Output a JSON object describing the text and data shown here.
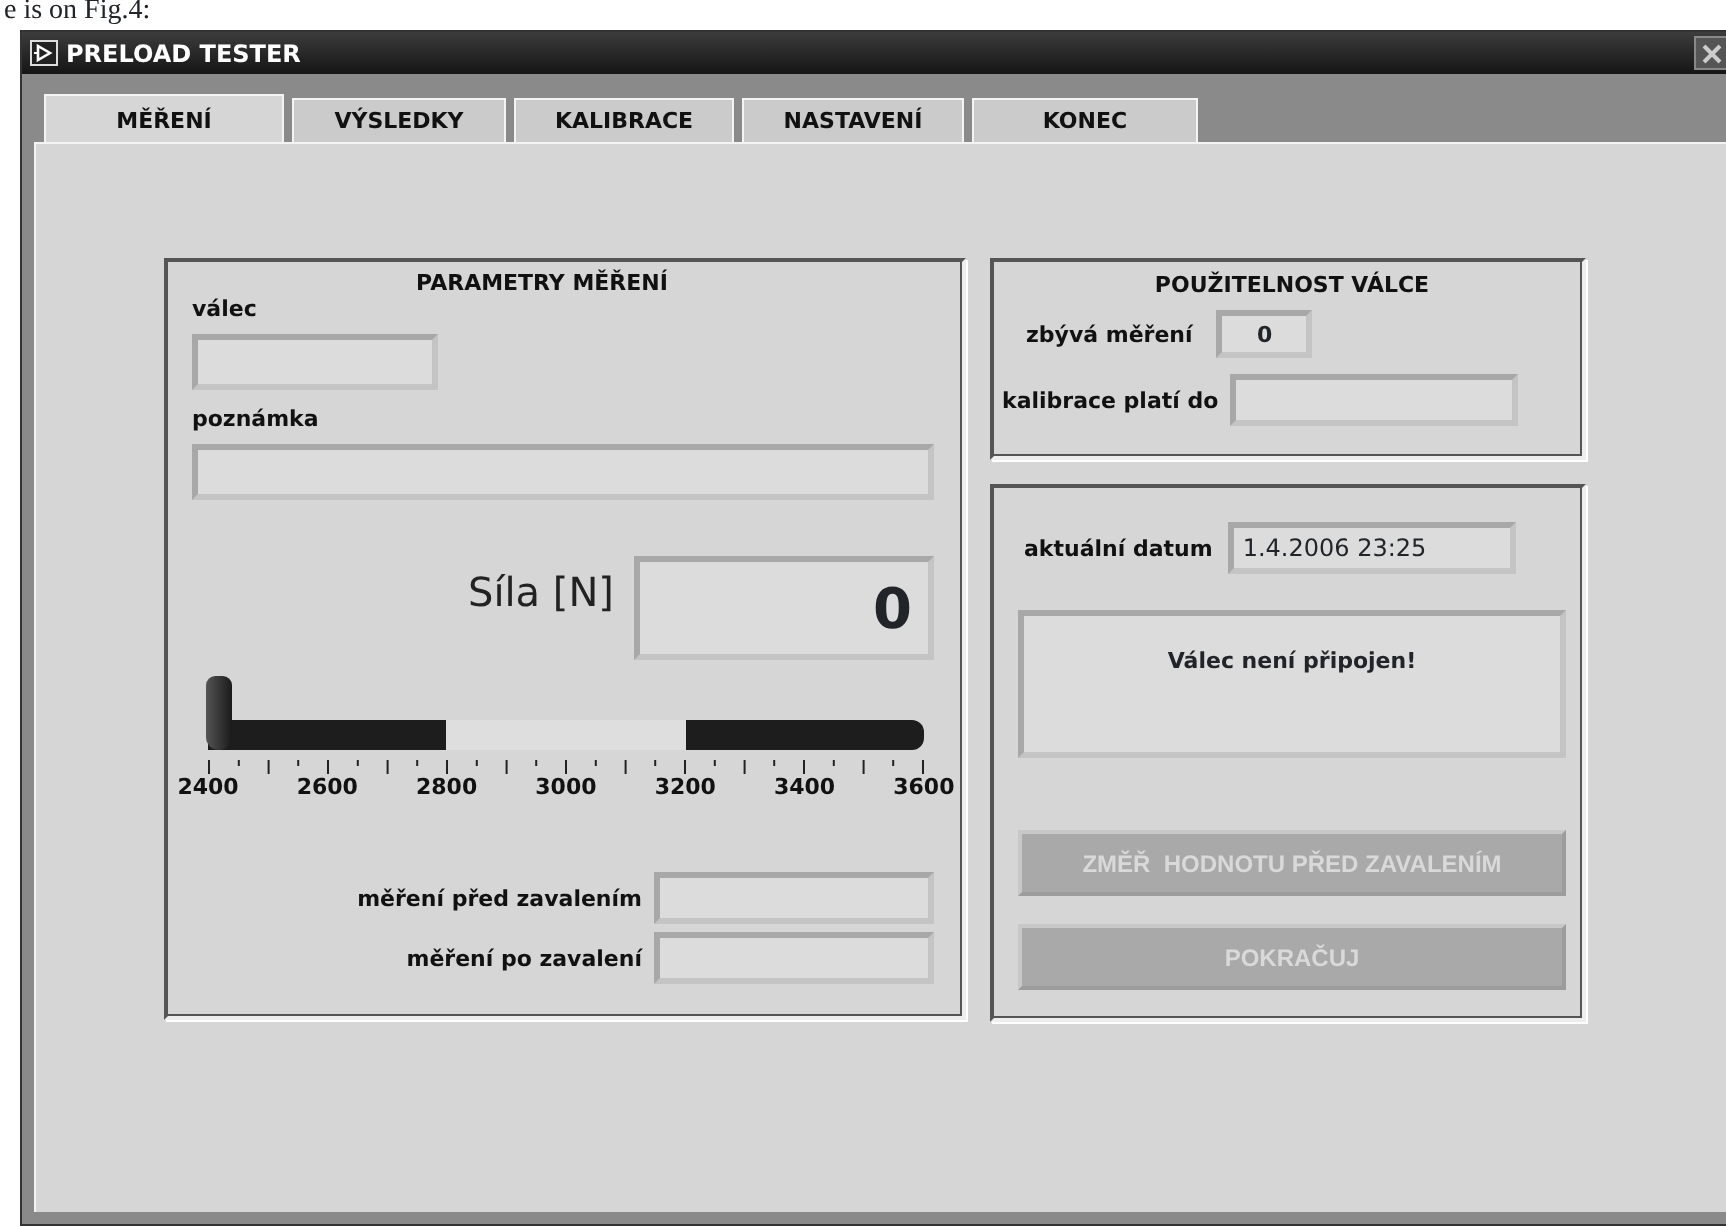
{
  "document_caption": "e is on Fig.4:",
  "window": {
    "title": "PRELOAD TESTER"
  },
  "tabs": [
    {
      "label": "MĚŘENÍ",
      "selected": true
    },
    {
      "label": "VÝSLEDKY",
      "selected": false
    },
    {
      "label": "KALIBRACE",
      "selected": false
    },
    {
      "label": "NASTAVENÍ",
      "selected": false
    },
    {
      "label": "KONEC",
      "selected": false
    }
  ],
  "measurement_panel": {
    "title": "PARAMETRY MĚŘENÍ",
    "fields": [
      {
        "label": "válec",
        "kind": "short"
      },
      {
        "label": "poznámka",
        "kind": "long"
      }
    ],
    "force": {
      "label": "Síla [N]",
      "value": "0"
    },
    "slider": {
      "level": 0,
      "ticks": [
        "2400",
        "2600",
        "2800",
        "3000",
        "3200",
        "3400",
        "3600"
      ]
    },
    "results": [
      {
        "label": "měření před zavalením"
      },
      {
        "label": "měření po zavalení"
      }
    ]
  },
  "usability_panel": {
    "title": "POUŽITELNOST VÁLCE",
    "remaining": {
      "label": "zbývá měření",
      "value": "0"
    },
    "calibration": {
      "label": "kalibrace platí do"
    }
  },
  "status_panel": {
    "date": {
      "label": "aktuální datum",
      "value": "1.4.2006 23:25"
    },
    "message": "Válec není připojen!",
    "buttons": [
      {
        "label": "ZMĚŘ  HODNOTU PŘED ZAVALENÍM",
        "disabled": true
      },
      {
        "label": "POKRAČUJ",
        "disabled": true
      }
    ]
  }
}
